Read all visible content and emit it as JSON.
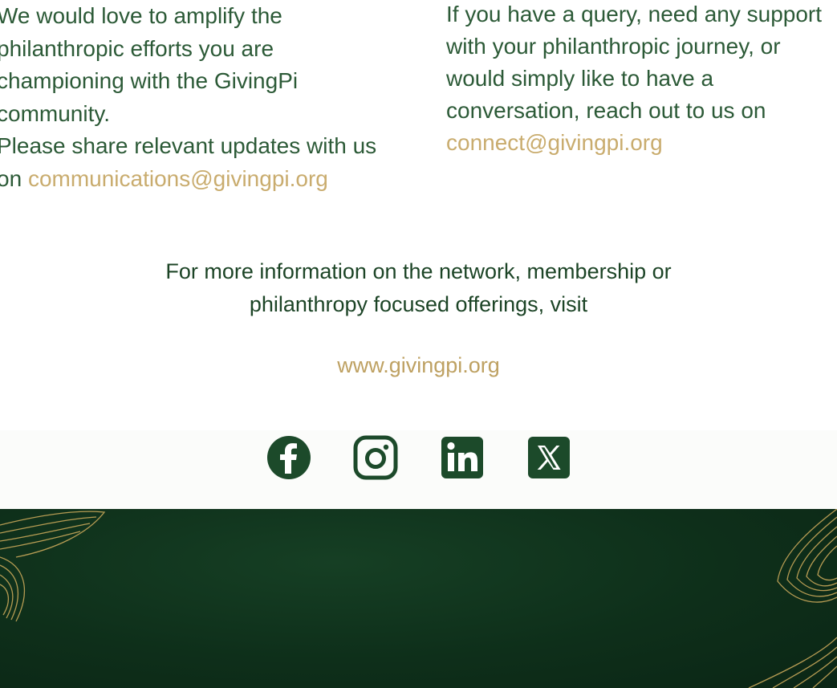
{
  "left_block": {
    "para1": "We would love to amplify the philanthropic efforts you are championing with the GivingPi community.",
    "para2_prefix": "Please share relevant updates with us on ",
    "email": "communications@givingpi.org"
  },
  "right_block": {
    "text": "If you have a query, need any support with your philanthropic journey, or would simply like to have a conversation, reach out to us on ",
    "email": "connect@givingpi.org"
  },
  "info": {
    "line1": "For more information on the network, membership or",
    "line2": "philanthropy focused offerings, visit"
  },
  "website": "www.givingpi.org",
  "social": [
    {
      "name": "facebook-icon"
    },
    {
      "name": "instagram-icon"
    },
    {
      "name": "linkedin-icon"
    },
    {
      "name": "x-twitter-icon"
    }
  ],
  "colors": {
    "brand_green": "#1e4a2a",
    "accent_gold": "#c9ac6e",
    "footer_green": "#0e2f1a"
  }
}
